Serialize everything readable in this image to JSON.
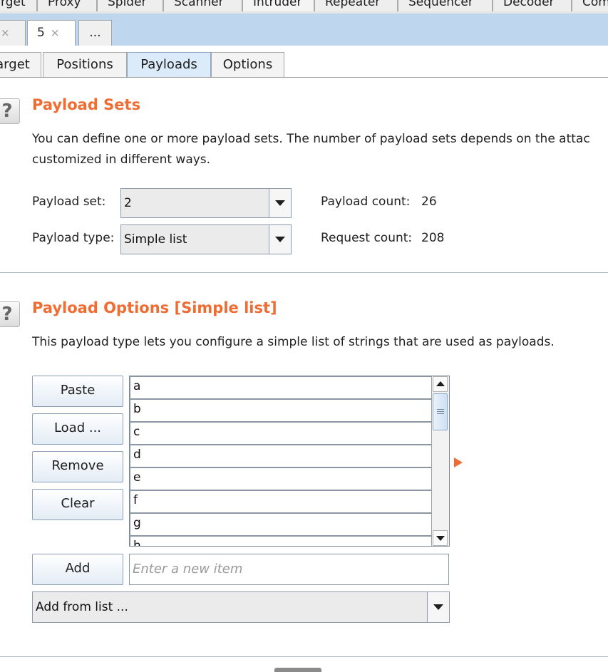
{
  "top_tabs": [
    "rget",
    "Proxy",
    "Spider",
    "Scanner",
    "Intruder",
    "Repeater",
    "Sequencer",
    "Decoder",
    "Com"
  ],
  "instance_tabs": [
    {
      "label": "",
      "close": "×"
    },
    {
      "label": "5",
      "close": "×"
    },
    {
      "label": "...",
      "close": ""
    }
  ],
  "sub_tabs": [
    "arget",
    "Positions",
    "Payloads",
    "Options"
  ],
  "payload_sets": {
    "title": "Payload Sets",
    "desc_line1": "You can define one or more payload sets. The number of payload sets depends on the attac",
    "desc_line2": "customized in different ways.",
    "set_label": "Payload set:",
    "set_value": "2",
    "type_label": "Payload type:",
    "type_value": "Simple list",
    "count_label": "Payload count:",
    "count_value": "26",
    "request_label": "Request count:",
    "request_value": "208"
  },
  "payload_options": {
    "title": "Payload Options [Simple list]",
    "desc": "This payload type lets you configure a simple list of strings that are used as payloads.",
    "buttons": {
      "paste": "Paste",
      "load": "Load ...",
      "remove": "Remove",
      "clear": "Clear",
      "add": "Add"
    },
    "items": [
      "a",
      "b",
      "c",
      "d",
      "e",
      "f",
      "g",
      "h"
    ],
    "new_item_placeholder": "Enter a new item",
    "add_from_list": "Add from list ..."
  },
  "colors": {
    "accent": "#ef6c33",
    "tab_bar": "#bfd7ee",
    "active_subtab": "#dcebf9"
  },
  "icons": [
    "help-icon",
    "dropdown-arrow-icon",
    "scroll-up-icon",
    "scroll-down-icon",
    "expand-arrow-icon"
  ]
}
